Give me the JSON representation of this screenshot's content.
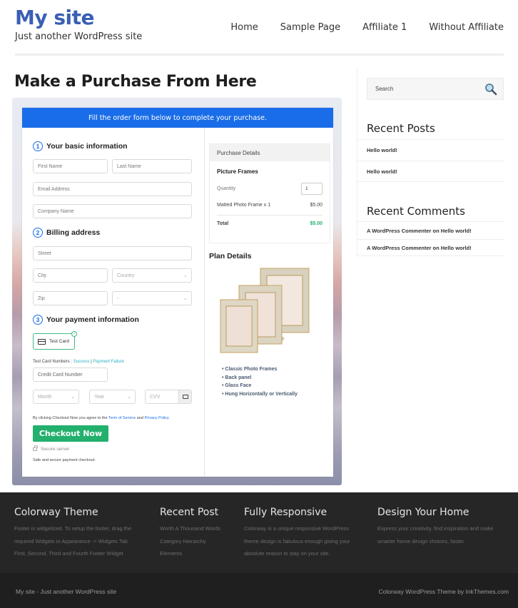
{
  "header": {
    "site_title": "My site",
    "tagline": "Just another WordPress site",
    "nav": [
      "Home",
      "Sample Page",
      "Affiliate 1",
      "Without Affiliate"
    ],
    "brand_color": "#3a5fb4"
  },
  "main": {
    "page_title": "Make a Purchase From Here",
    "form": {
      "banner": "Fill the order form below to complete your purchase.",
      "banner_color": "#1a6de8",
      "step1": {
        "num": "1",
        "label": "Your basic information"
      },
      "first_name": "First Name",
      "last_name": "Last Name",
      "email": "Email Address",
      "company": "Company Name",
      "step2": {
        "num": "2",
        "label": "Billing address"
      },
      "street": "Street",
      "city": "City",
      "country": "Country",
      "zip": "Zip",
      "state": "-",
      "step3": {
        "num": "3",
        "label": "Your payment information"
      },
      "test_card": "Test Card",
      "test_numbers_label": "Test Card Numbers :",
      "success_link": "Success",
      "separator": "|",
      "failure_link": "Payment Failure",
      "card_number": "Credit Card Number",
      "month": "Month",
      "year": "Year",
      "cvv": "CVV",
      "terms_prefix": "By clicking Checkout Now you agree to the",
      "terms_link": "Term of Service",
      "terms_and": "and",
      "privacy_link": "Privacy Policy",
      "checkout": "Checkout Now",
      "checkout_color": "#23b06d",
      "secure": "Secure server",
      "safe": "Safe and secure payment checkout."
    },
    "purchase": {
      "title": "Purchase Details",
      "product": "Picture Frames",
      "quantity_label": "Quantity",
      "quantity_value": "1",
      "line_item": "Matted Photo Frame x 1",
      "line_price": "$5.00",
      "total_label": "Total",
      "total_value": "$5.00",
      "total_color": "#23b06d"
    },
    "plan": {
      "title": "Plan Details",
      "features": [
        "Classic Photo Frames",
        "Back panel",
        "Glass Face",
        "Hung Horizontally or Vertically"
      ]
    }
  },
  "sidebar": {
    "search_placeholder": "Search",
    "recent_posts_title": "Recent Posts",
    "recent_posts": [
      "Hello world!",
      "Hello world!"
    ],
    "recent_comments_title": "Recent Comments",
    "recent_comments": [
      "A WordPress Commenter on Hello world!",
      "A WordPress Commenter on Hello world!"
    ]
  },
  "footer": {
    "cols": [
      {
        "title": "Colorway Theme",
        "lines": [
          "Footer is widgetized. To setup the footer, drag the",
          "required Widgets in Appearance -> Widgets Tab",
          "First, Second, Third and Fourth Footer Widget"
        ]
      },
      {
        "title": "Recent Post",
        "lines": [
          "Worth A Thousand Words",
          "Category Hierarchy",
          "Elements"
        ]
      },
      {
        "title": "Fully Responsive",
        "lines": [
          "Colorway is a unique responsive WordPress",
          "theme design is fabulous enough giving your",
          "absolute reason to stay on your site."
        ]
      },
      {
        "title": "Design Your Home",
        "lines": [
          "Express your creativity, find inspiration and make",
          "smarter home design choices, faster."
        ]
      }
    ],
    "bottom_left": "My site - Just another WordPress site",
    "bottom_right": "Colorway WordPress Theme by InkThemes.com"
  }
}
